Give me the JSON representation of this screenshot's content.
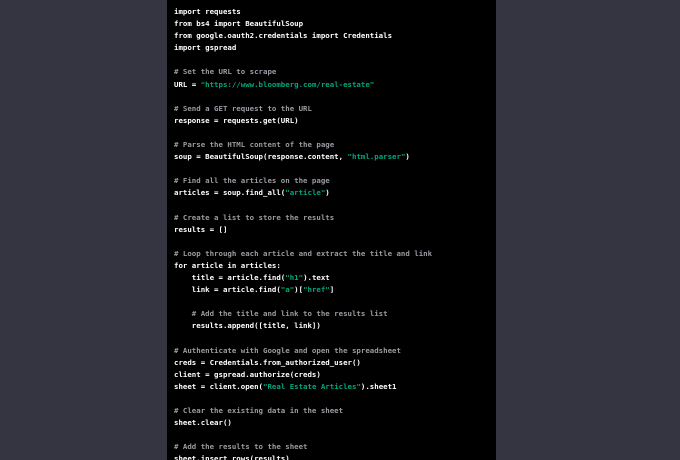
{
  "code_block": {
    "language": "python",
    "colors": {
      "background": "#000000",
      "page_background": "#343541",
      "plain": "#ffffff",
      "comment": "#9b9ba2",
      "string": "#00a67d"
    },
    "lines": [
      [
        {
          "t": "plain",
          "v": "import requests"
        }
      ],
      [
        {
          "t": "plain",
          "v": "from bs4 import BeautifulSoup"
        }
      ],
      [
        {
          "t": "plain",
          "v": "from google.oauth2.credentials import Credentials"
        }
      ],
      [
        {
          "t": "plain",
          "v": "import gspread"
        }
      ],
      [],
      [
        {
          "t": "comment",
          "v": "# Set the URL to scrape"
        }
      ],
      [
        {
          "t": "plain",
          "v": "URL = "
        },
        {
          "t": "string",
          "v": "\"https://www.bloomberg.com/real-estate\""
        }
      ],
      [],
      [
        {
          "t": "comment",
          "v": "# Send a GET request to the URL"
        }
      ],
      [
        {
          "t": "plain",
          "v": "response = requests.get(URL)"
        }
      ],
      [],
      [
        {
          "t": "comment",
          "v": "# Parse the HTML content of the page"
        }
      ],
      [
        {
          "t": "plain",
          "v": "soup = BeautifulSoup(response.content, "
        },
        {
          "t": "string",
          "v": "\"html.parser\""
        },
        {
          "t": "plain",
          "v": ")"
        }
      ],
      [],
      [
        {
          "t": "comment",
          "v": "# Find all the articles on the page"
        }
      ],
      [
        {
          "t": "plain",
          "v": "articles = soup.find_all("
        },
        {
          "t": "string",
          "v": "\"article\""
        },
        {
          "t": "plain",
          "v": ")"
        }
      ],
      [],
      [
        {
          "t": "comment",
          "v": "# Create a list to store the results"
        }
      ],
      [
        {
          "t": "plain",
          "v": "results = []"
        }
      ],
      [],
      [
        {
          "t": "comment",
          "v": "# Loop through each article and extract the title and link"
        }
      ],
      [
        {
          "t": "plain",
          "v": "for article in articles:"
        }
      ],
      [
        {
          "t": "plain",
          "v": "    title = article.find("
        },
        {
          "t": "string",
          "v": "\"h1\""
        },
        {
          "t": "plain",
          "v": ").text"
        }
      ],
      [
        {
          "t": "plain",
          "v": "    link = article.find("
        },
        {
          "t": "string",
          "v": "\"a\""
        },
        {
          "t": "plain",
          "v": ")["
        },
        {
          "t": "string",
          "v": "\"href\""
        },
        {
          "t": "plain",
          "v": "]"
        }
      ],
      [],
      [
        {
          "t": "comment",
          "v": "    # Add the title and link to the results list"
        }
      ],
      [
        {
          "t": "plain",
          "v": "    results.append([title, link])"
        }
      ],
      [],
      [
        {
          "t": "comment",
          "v": "# Authenticate with Google and open the spreadsheet"
        }
      ],
      [
        {
          "t": "plain",
          "v": "creds = Credentials.from_authorized_user()"
        }
      ],
      [
        {
          "t": "plain",
          "v": "client = gspread.authorize(creds)"
        }
      ],
      [
        {
          "t": "plain",
          "v": "sheet = client.open("
        },
        {
          "t": "string",
          "v": "\"Real Estate Articles\""
        },
        {
          "t": "plain",
          "v": ").sheet1"
        }
      ],
      [],
      [
        {
          "t": "comment",
          "v": "# Clear the existing data in the sheet"
        }
      ],
      [
        {
          "t": "plain",
          "v": "sheet.clear()"
        }
      ],
      [],
      [
        {
          "t": "comment",
          "v": "# Add the results to the sheet"
        }
      ],
      [
        {
          "t": "plain",
          "v": "sheet.insert_rows(results)"
        }
      ]
    ]
  }
}
